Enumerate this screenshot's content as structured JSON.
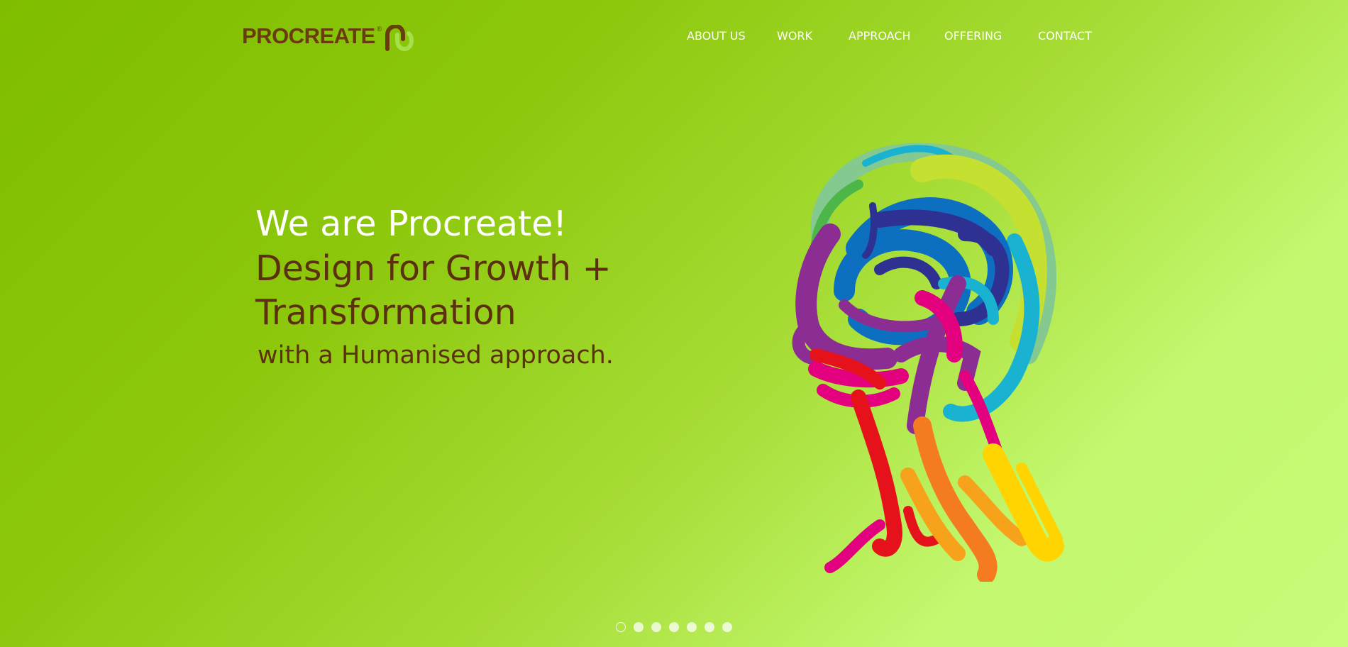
{
  "brand": {
    "name": "PROCREATE",
    "registered_mark": "®",
    "text_color": "#6a3b0c",
    "mark_colors": [
      "#6a3b0c",
      "#a4e04a"
    ]
  },
  "nav": {
    "items": [
      {
        "label": "ABOUT US"
      },
      {
        "label": "WORK"
      },
      {
        "label": "APPROACH"
      },
      {
        "label": "OFFERING"
      },
      {
        "label": "CONTACT"
      }
    ]
  },
  "hero": {
    "headline": "We are Procreate!",
    "tagline_line1": "Design for Growth +",
    "tagline_line2": "Transformation",
    "subline": "with a Humanised approach."
  },
  "illustration": {
    "icon": "colorful-brushstroke-head-icon",
    "colors": [
      "#2e3192",
      "#0d6fc0",
      "#19b2d0",
      "#8c2d94",
      "#e3007e",
      "#e6121b",
      "#f57b20",
      "#ffd400",
      "#c6e031",
      "#84c990"
    ]
  },
  "slider": {
    "count": 7,
    "active_index": 0
  },
  "colors": {
    "background_start": "#7fbd00",
    "background_end": "#c8fb78",
    "headline": "#ffffff",
    "tagline": "#5c300f",
    "nav_text": "#ffffff"
  }
}
